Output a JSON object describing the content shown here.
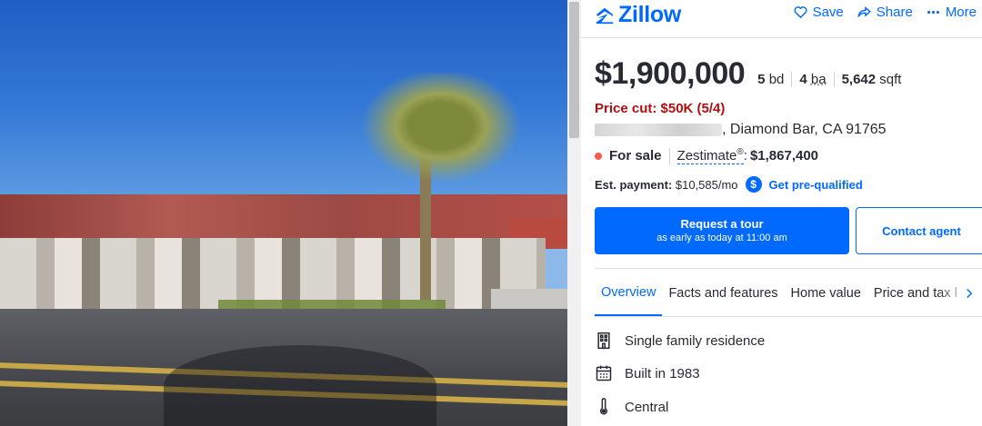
{
  "header": {
    "logo_text": "Zillow",
    "actions": [
      {
        "label": "Save",
        "icon": "heart-icon"
      },
      {
        "label": "Share",
        "icon": "share-icon"
      },
      {
        "label": "More",
        "icon": "more-dots-icon"
      }
    ]
  },
  "listing": {
    "price": "$1,900,000",
    "beds_value": "5",
    "beds_unit": "bd",
    "baths_value": "4",
    "baths_unit": "ba",
    "sqft_value": "5,642",
    "sqft_unit": "sqft",
    "price_cut": "Price cut: $50K (5/4)",
    "address_visible": ", Diamond Bar, CA 91765",
    "status": "For sale",
    "zestimate_label": "Zestimate",
    "zestimate_mark": "®",
    "zestimate_colon": ":",
    "zestimate_value": "$1,867,400",
    "payment_label": "Est. payment:",
    "payment_value": "$10,585/mo",
    "prequal_label": "Get pre-qualified"
  },
  "cta": {
    "tour_title": "Request a tour",
    "tour_sub": "as early as today at 11:00 am",
    "contact": "Contact agent"
  },
  "tabs": [
    {
      "label": "Overview",
      "active": true
    },
    {
      "label": "Facts and features",
      "active": false
    },
    {
      "label": "Home value",
      "active": false
    },
    {
      "label": "Price and tax h",
      "active": false
    }
  ],
  "features": [
    {
      "label": "Single family residence",
      "icon": "building-icon"
    },
    {
      "label": "Built in 1983",
      "icon": "calendar-icon"
    },
    {
      "label": "Central",
      "icon": "thermometer-icon"
    }
  ],
  "colors": {
    "brand_blue": "#006aff",
    "price_cut_red": "#b00f0f",
    "status_dot": "#ff5a4c"
  }
}
